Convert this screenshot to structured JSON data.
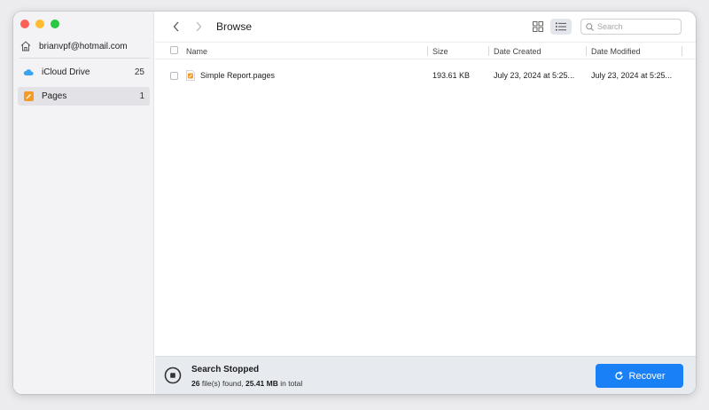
{
  "sidebar": {
    "account": "brianvpf@hotmail.com",
    "items": [
      {
        "label": "iCloud Drive",
        "count": "25",
        "icon": "cloud-icon"
      },
      {
        "label": "Pages",
        "count": "1",
        "icon": "pages-app-icon"
      }
    ]
  },
  "toolbar": {
    "title": "Browse",
    "search_placeholder": "Search"
  },
  "table": {
    "columns": [
      "Name",
      "Size",
      "Date Created",
      "Date Modified"
    ],
    "rows": [
      {
        "name": "Simple Report.pages",
        "size": "193.61 KB",
        "created": "July 23, 2024 at 5:25...",
        "modified": "July 23, 2024 at 5:25..."
      }
    ]
  },
  "footer": {
    "status_title": "Search Stopped",
    "file_count": "26",
    "found_text": "file(s) found,",
    "total_size": "25.41 MB",
    "total_text": "in total",
    "recover_label": "Recover"
  },
  "colors": {
    "accent": "#1a80f5",
    "pages_orange": "#f59a23",
    "icloud_blue": "#3aa3f0"
  }
}
